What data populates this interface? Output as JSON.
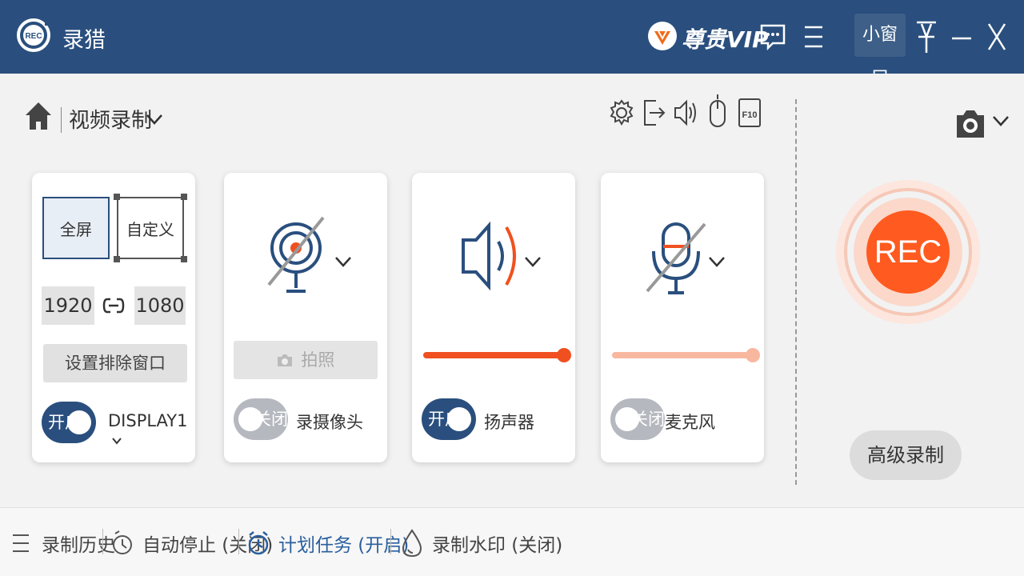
{
  "titlebar": {
    "app_title": "录猎",
    "vip_label": "尊贵VIP",
    "mini_window_label": "小窗口"
  },
  "toolbar": {
    "mode_label": "视频录制"
  },
  "area_card": {
    "fullscreen_label": "全屏",
    "custom_label": "自定义",
    "width": "1920",
    "height": "1080",
    "exclude_button": "设置排除窗口",
    "toggle_label": "开启",
    "toggle_on": true,
    "display_label": "DISPLAY1"
  },
  "camera_card": {
    "photo_button": "拍照",
    "toggle_label": "关闭",
    "toggle_on": false,
    "device_label": "录摄像头"
  },
  "speaker_card": {
    "toggle_label": "开启",
    "toggle_on": true,
    "device_label": "扬声器",
    "volume": 1.0,
    "color": "#f05020"
  },
  "mic_card": {
    "toggle_label": "关闭",
    "toggle_on": false,
    "device_label": "麦克风",
    "volume": 1.0,
    "color": "#f8b8a0"
  },
  "rec": {
    "label": "REC",
    "advanced_button": "高级录制",
    "color": "#ff5a1f"
  },
  "bottombar": {
    "history": "录制历史",
    "auto_stop": "自动停止 (关闭)",
    "schedule": "计划任务 (开启)",
    "watermark": "录制水印 (关闭)"
  },
  "colors": {
    "titlebar_bg": "#2a4f7e",
    "accent": "#2a4f7e",
    "rec_orange": "#ff5a1f"
  }
}
